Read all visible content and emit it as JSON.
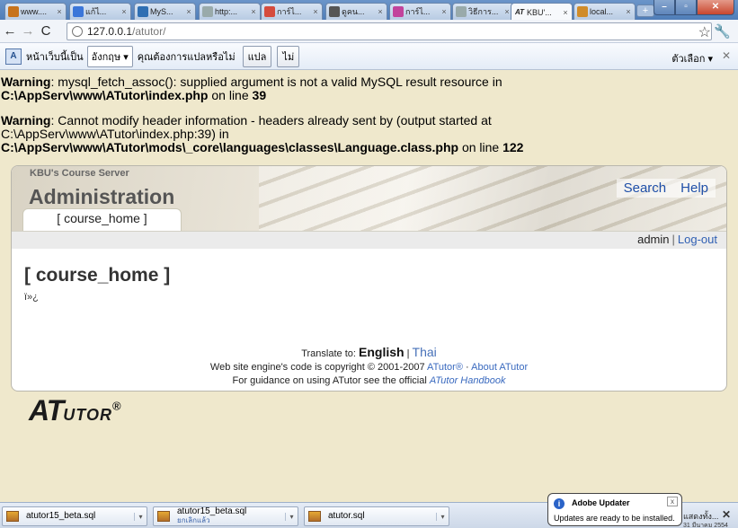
{
  "browser": {
    "tabs": [
      {
        "icon": "cube-icon",
        "color": "#c7731c",
        "label": "www...."
      },
      {
        "icon": "google-icon",
        "color": "#3b76d9",
        "label": "แก้ไ..."
      },
      {
        "icon": "phpmyadmin-icon",
        "color": "#2f6fb3",
        "label": "MyS..."
      },
      {
        "icon": "page-icon",
        "color": "#9aa",
        "label": "http:..."
      },
      {
        "icon": "google-icon",
        "color": "#d54b3d",
        "label": "การ์ไ..."
      },
      {
        "icon": "book-icon",
        "color": "#555",
        "label": "ดูคน..."
      },
      {
        "icon": "flower-icon",
        "color": "#c2439c",
        "label": "การ์ไ..."
      },
      {
        "icon": "page-icon",
        "color": "#9aa",
        "label": "วิธีการ..."
      },
      {
        "icon": "atutor-icon",
        "color": "#222",
        "label": "KBU'..."
      },
      {
        "icon": "pma-icon",
        "color": "#d08c2a",
        "label": "local..."
      }
    ],
    "new_tab": "+",
    "window_buttons": {
      "minimize": "–",
      "maximize": "▫",
      "close": "✕"
    },
    "address": {
      "host": "127.0.0.1",
      "path": "/atutor/"
    },
    "nav": {
      "back": "←",
      "forward": "→",
      "reload": "C"
    }
  },
  "translate_bar": {
    "icon_text": "A",
    "message": "หน้าเว็บนี้เป็น",
    "language": "อังกฤษ ▾",
    "question": "คุณต้องการแปลหรือไม่",
    "translate_button": "แปล",
    "no_button": "ไม่",
    "options": "ตัวเลือก ▾",
    "close": "✕"
  },
  "warnings": [
    {
      "label": "Warning",
      "message": ": mysql_fetch_assoc(): supplied argument is not a valid MySQL result resource in",
      "path": "C:\\AppServ\\www\\ATutor\\index.php",
      "on_line": " on line ",
      "line": "39"
    },
    {
      "label": "Warning",
      "message": ": Cannot modify header information - headers already sent by (output started at",
      "message2": "C:\\AppServ\\www\\ATutor\\index.php:39) in",
      "path": "C:\\AppServ\\www\\ATutor\\mods\\_core\\languages\\classes\\Language.class.php",
      "on_line": " on line ",
      "line": "122"
    }
  ],
  "atutor": {
    "site_name": "KBU's Course Server",
    "section_title": "Administration",
    "course_tab": "[ course_home ]",
    "search_link": "Search",
    "help_link": "Help",
    "username": "admin",
    "separator": "|",
    "logout": "Log-out",
    "page_heading": "[ course_home ]",
    "garbled_text": "ï»¿",
    "translate_to": "Translate to: ",
    "lang_current": "English",
    "lang_sep": " | ",
    "lang_alt": "Thai",
    "copyright": "Web site engine's code is copyright © 2001-2007 ",
    "atutor_link": "ATutor®",
    "dot": " · ",
    "about_link": "About ATutor",
    "guidance": "For guidance on using ATutor see the official ",
    "handbook_link": "ATutor Handbook",
    "logo_a": "AT",
    "logo_rest": "UTOR",
    "logo_reg": "®"
  },
  "downloads": [
    {
      "name": "atutor15_beta.sql",
      "sub": ""
    },
    {
      "name": "atutor15_beta.sql",
      "sub": "ยกเลิกแล้ว"
    },
    {
      "name": "atutor.sql",
      "sub": ""
    }
  ],
  "shelf_more": "แสดงทั้ง...",
  "shelf_close": "✕",
  "notification": {
    "title": "Adobe Updater",
    "text": "Updates are ready to be installed.",
    "close": "x",
    "icon": "i"
  },
  "clock_text": "31 มีนาคม 2554"
}
